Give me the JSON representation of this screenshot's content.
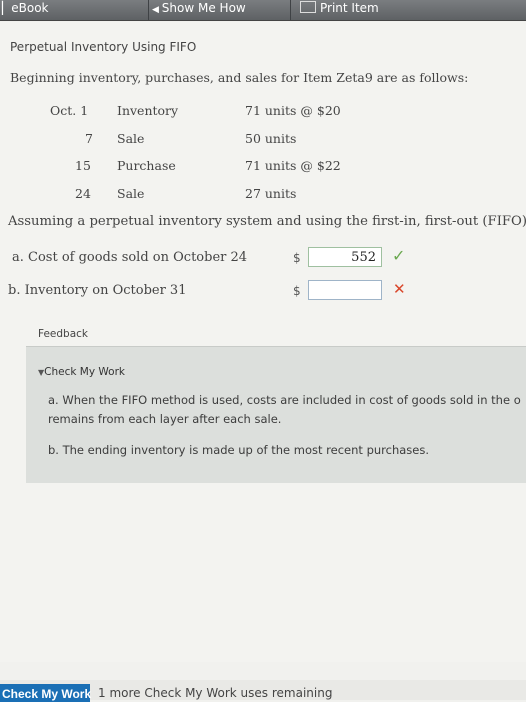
{
  "toolbar": {
    "ebook": "eBook",
    "show_me_how": "Show Me How",
    "print_item": "Print Item"
  },
  "problem": {
    "title": "Perpetual Inventory Using FIFO",
    "intro": "Beginning inventory, purchases, and sales for Item Zeta9 are as follows:",
    "rows": [
      {
        "date": "Oct. 1",
        "type": "Inventory",
        "detail": "71 units @ $20"
      },
      {
        "date": "7",
        "type": "Sale",
        "detail": "50 units"
      },
      {
        "date": "15",
        "type": "Purchase",
        "detail": "71 units @ $22"
      },
      {
        "date": "24",
        "type": "Sale",
        "detail": "27 units"
      }
    ],
    "assumption": "Assuming a perpetual inventory system and using the first-in, first-out (FIFO)"
  },
  "questions": {
    "a_label": "a. Cost of goods sold on October 24",
    "a_currency": "$",
    "a_value": "552",
    "a_status": "correct",
    "b_label": "b. Inventory on October 31",
    "b_currency": "$",
    "b_value": "",
    "b_status": "incorrect"
  },
  "feedback": {
    "label": "Feedback",
    "check_header": "Check My Work",
    "a_line1": "a. When the FIFO method is used, costs are included in cost of goods sold in the o",
    "a_line2": "remains from each layer after each sale.",
    "b_line": "b. The ending inventory is made up of the most recent purchases."
  },
  "footer": {
    "check_button": "Check My Work",
    "remaining": "1 more Check My Work uses remaining"
  },
  "colors": {
    "correct": "#6aa84f",
    "incorrect": "#d9472b",
    "button": "#1a6fb5"
  }
}
